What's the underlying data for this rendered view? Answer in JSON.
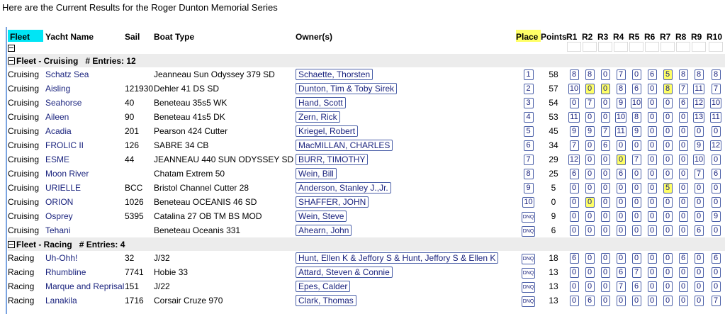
{
  "intro": "Here are the Current Results for the Roger Dunton Memorial Series",
  "headers": {
    "fleet": "Fleet",
    "yacht": "Yacht Name",
    "sail": "Sail",
    "type": "Boat Type",
    "owner": "Owner(s)",
    "place": "Place",
    "points": "Points",
    "races": [
      "R1",
      "R2",
      "R3",
      "R4",
      "R5",
      "R6",
      "R7",
      "R8",
      "R9",
      "R10"
    ]
  },
  "groups": [
    {
      "label": "Fleet - Cruising",
      "entries_label": "# Entries: 12",
      "rows": [
        {
          "fleet": "Cruising",
          "yacht": "Schatz Sea",
          "sail": "",
          "type": "Jeanneau Sun Odyssey 379 SD",
          "owner": "Schaette, Thorsten",
          "place": "1",
          "points": "58",
          "races": [
            "8",
            "8",
            "0",
            "7",
            "0",
            "6",
            "5",
            "8",
            "8",
            "8"
          ],
          "hl": [
            6
          ]
        },
        {
          "fleet": "Cruising",
          "yacht": "Aisling",
          "sail": "121930",
          "type": "Dehler 41 DS SD",
          "owner": "Dunton, Tim & Toby Sirek",
          "place": "2",
          "points": "57",
          "races": [
            "10",
            "0",
            "0",
            "8",
            "6",
            "0",
            "8",
            "7",
            "11",
            "7"
          ],
          "hl": [
            1,
            2,
            6
          ]
        },
        {
          "fleet": "Cruising",
          "yacht": "Seahorse",
          "sail": "40",
          "type": "Beneteau 35s5 WK",
          "owner": "Hand, Scott",
          "place": "3",
          "points": "54",
          "races": [
            "0",
            "7",
            "0",
            "9",
            "10",
            "0",
            "0",
            "6",
            "12",
            "10"
          ],
          "hl": []
        },
        {
          "fleet": "Cruising",
          "yacht": "Aileen",
          "sail": "90",
          "type": "Beneteau 41s5 DK",
          "owner": "Zern, Rick",
          "place": "4",
          "points": "53",
          "races": [
            "11",
            "0",
            "0",
            "10",
            "8",
            "0",
            "0",
            "0",
            "13",
            "11"
          ],
          "hl": []
        },
        {
          "fleet": "Cruising",
          "yacht": "Acadia",
          "sail": "201",
          "type": "Pearson 424 Cutter",
          "owner": "Kriegel, Robert",
          "place": "5",
          "points": "45",
          "races": [
            "9",
            "9",
            "7",
            "11",
            "9",
            "0",
            "0",
            "0",
            "0",
            "0"
          ],
          "hl": []
        },
        {
          "fleet": "Cruising",
          "yacht": "FROLIC II",
          "sail": "126",
          "type": "SABRE 34 CB",
          "owner": "MacMILLAN, CHARLES",
          "place": "6",
          "points": "34",
          "races": [
            "7",
            "0",
            "6",
            "0",
            "0",
            "0",
            "0",
            "0",
            "9",
            "12"
          ],
          "hl": []
        },
        {
          "fleet": "Cruising",
          "yacht": "ESME",
          "sail": "44",
          "type": "JEANNEAU 440 SUN ODYSSEY SD",
          "owner": "BURR, TIMOTHY",
          "place": "7",
          "points": "29",
          "races": [
            "12",
            "0",
            "0",
            "0",
            "7",
            "0",
            "0",
            "0",
            "10",
            "0"
          ],
          "hl": [
            3
          ]
        },
        {
          "fleet": "Cruising",
          "yacht": "Moon River",
          "sail": "",
          "type": "Chatam Extrem 50",
          "owner": "Wein, Bill",
          "place": "8",
          "points": "25",
          "races": [
            "6",
            "0",
            "0",
            "6",
            "0",
            "0",
            "0",
            "0",
            "7",
            "6"
          ],
          "hl": []
        },
        {
          "fleet": "Cruising",
          "yacht": "URIELLE",
          "sail": "BCC",
          "type": "Bristol Channel Cutter 28",
          "owner": "Anderson, Stanley J.,Jr.",
          "place": "9",
          "points": "5",
          "races": [
            "0",
            "0",
            "0",
            "0",
            "0",
            "0",
            "5",
            "0",
            "0",
            "0"
          ],
          "hl": [
            6
          ]
        },
        {
          "fleet": "Cruising",
          "yacht": "ORION",
          "sail": "1026",
          "type": "Beneteau OCEANIS 46 SD",
          "owner": "SHAFFER, JOHN",
          "place": "10",
          "points": "0",
          "races": [
            "0",
            "0",
            "0",
            "0",
            "0",
            "0",
            "0",
            "0",
            "0",
            "0"
          ],
          "hl": [
            1
          ]
        },
        {
          "fleet": "Cruising",
          "yacht": "Osprey",
          "sail": "5395",
          "type": "Catalina 27 OB TM BS MOD",
          "owner": "Wein, Steve",
          "place": "DNQ",
          "points": "9",
          "races": [
            "0",
            "0",
            "0",
            "0",
            "0",
            "0",
            "0",
            "0",
            "0",
            "9"
          ],
          "hl": []
        },
        {
          "fleet": "Cruising",
          "yacht": "Tehani",
          "sail": "",
          "type": "Beneteau Oceanis 331",
          "owner": "Ahearn, John",
          "place": "DNQ",
          "points": "6",
          "races": [
            "0",
            "0",
            "0",
            "0",
            "0",
            "0",
            "0",
            "0",
            "6",
            "0"
          ],
          "hl": []
        }
      ]
    },
    {
      "label": "Fleet - Racing",
      "entries_label": "# Entries: 4",
      "rows": [
        {
          "fleet": "Racing",
          "yacht": "Uh-Ohh!",
          "sail": "32",
          "type": "J/32",
          "owner": "Hunt, Ellen K & Jeffory S & Hunt, Jeffory S & Ellen K",
          "place": "DNQ",
          "points": "18",
          "races": [
            "6",
            "0",
            "0",
            "0",
            "0",
            "0",
            "0",
            "6",
            "0",
            "6"
          ],
          "hl": []
        },
        {
          "fleet": "Racing",
          "yacht": "Rhumbline",
          "sail": "7741",
          "type": "Hobie 33",
          "owner": "Attard, Steven & Connie",
          "place": "DNQ",
          "points": "13",
          "races": [
            "0",
            "0",
            "0",
            "6",
            "7",
            "0",
            "0",
            "0",
            "0",
            "0"
          ],
          "hl": []
        },
        {
          "fleet": "Racing",
          "yacht": "Marque and Reprisal",
          "sail": "151",
          "type": "J/22",
          "owner": "Epes, Calder",
          "place": "DNQ",
          "points": "13",
          "races": [
            "0",
            "0",
            "0",
            "7",
            "6",
            "0",
            "0",
            "0",
            "0",
            "0"
          ],
          "hl": []
        },
        {
          "fleet": "Racing",
          "yacht": "Lanakila",
          "sail": "1716",
          "type": "Corsair Cruze 970",
          "owner": "Clark, Thomas",
          "place": "DNQ",
          "points": "13",
          "races": [
            "0",
            "6",
            "0",
            "0",
            "0",
            "0",
            "0",
            "0",
            "0",
            "7"
          ],
          "hl": []
        }
      ]
    }
  ]
}
